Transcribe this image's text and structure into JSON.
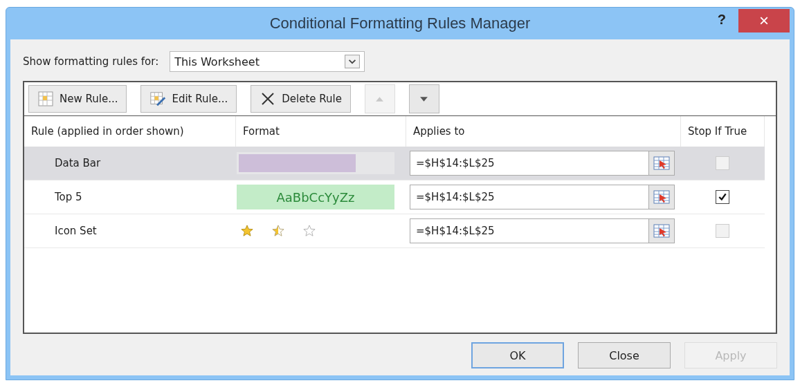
{
  "window": {
    "title": "Conditional Formatting Rules Manager",
    "help": "?",
    "close": "×"
  },
  "show_for": {
    "label": "Show formatting rules for:",
    "value": "This Worksheet"
  },
  "toolbar": [
    {
      "kind": "new",
      "label": "New Rule...",
      "disabled": false
    },
    {
      "kind": "edit",
      "label": "Edit Rule...",
      "disabled": false
    },
    {
      "kind": "delete",
      "label": "Delete Rule",
      "disabled": false
    },
    {
      "kind": "up",
      "disabled": true
    },
    {
      "kind": "down",
      "disabled": false
    }
  ],
  "table": {
    "columns": [
      "Rule (applied in order shown)",
      "Format",
      "Applies to",
      "Stop If True"
    ],
    "rows": [
      {
        "rule": "Data Bar",
        "format": {
          "kind": "data_bar",
          "level": 0.75
        },
        "applies_to": "=$H$14:$L$25",
        "stop_if_true": false,
        "stop_enabled": false,
        "selected": true
      },
      {
        "rule": "Top 5",
        "format": {
          "kind": "text_style",
          "sample": "AaBbCcYyZz"
        },
        "applies_to": "=$H$14:$L$25",
        "stop_if_true": true,
        "stop_enabled": true,
        "selected": false
      },
      {
        "rule": "Icon Set",
        "format": {
          "kind": "icon_set"
        },
        "applies_to": "=$H$14:$L$25",
        "stop_if_true": false,
        "stop_enabled": false,
        "selected": false
      }
    ]
  },
  "buttons": [
    {
      "label": "OK",
      "default": true,
      "disabled": false
    },
    {
      "label": "Close",
      "default": false,
      "disabled": false
    },
    {
      "label": "Apply",
      "default": false,
      "disabled": true
    }
  ]
}
